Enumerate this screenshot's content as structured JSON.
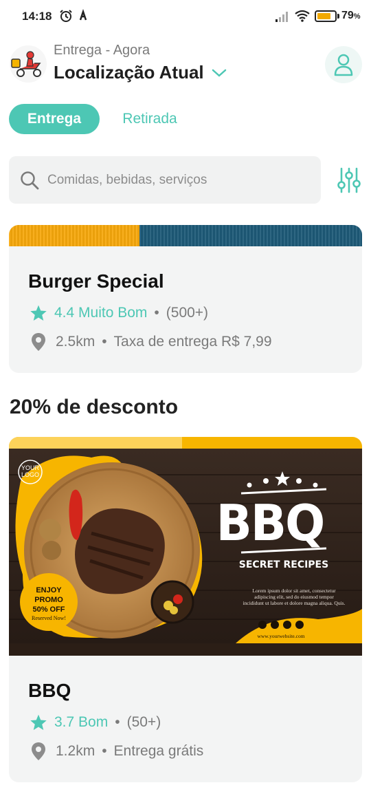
{
  "status_bar": {
    "time": "14:18",
    "battery_pct": "79",
    "battery_pct_unit": "%",
    "battery_level": 0.79,
    "icons": [
      "alarm-icon",
      "app-notification-icon",
      "signal-icon",
      "wifi-icon",
      "battery-icon"
    ]
  },
  "header": {
    "delivery_label": "Entrega - Agora",
    "location_title": "Localização Atual",
    "icons": [
      "delivery-scooter-icon",
      "chevron-down-icon",
      "profile-icon"
    ]
  },
  "mode_toggle": {
    "delivery": "Entrega",
    "pickup": "Retirada",
    "active": "delivery"
  },
  "search": {
    "placeholder": "Comidas, bebidas, serviços",
    "value": "",
    "icons": [
      "search-icon",
      "filter-sliders-icon"
    ]
  },
  "restaurants": [
    {
      "name": "Burger Special",
      "rating": "4.4 Muito Bom",
      "reviews": "(500+)",
      "distance": "2.5km",
      "delivery_fee": "Taxa de entrega R$ 7,99"
    }
  ],
  "promo_section": {
    "title": "20% de desconto",
    "restaurant": {
      "name": "BBQ",
      "rating": "3.7 Bom",
      "reviews": "(50+)",
      "distance": "1.2km",
      "delivery_fee": "Entrega grátis"
    },
    "banner": {
      "logo_line1": "YOUR",
      "logo_line2": "LOGO",
      "headline": "BBQ",
      "subheadline": "SECRET RECIPES",
      "body_text_line1": "Lorem ipsum dolor sit amet, consectetur",
      "body_text_line2": "adipiscing elit, sed do eiusmod tempor",
      "body_text_line3": "incididunt ut labore et dolore magna aliqua. Quis.",
      "promo_line1": "ENJOY",
      "promo_line2": "PROMO",
      "promo_line3": "50% OFF",
      "promo_line4": "Reserved Now!",
      "website": "www.yourwebsite.com"
    }
  },
  "colors": {
    "accent": "#4dc7b4",
    "card_bg": "#f3f4f4",
    "muted_text": "#7a7a7a",
    "bbq_yellow": "#f7b500"
  }
}
